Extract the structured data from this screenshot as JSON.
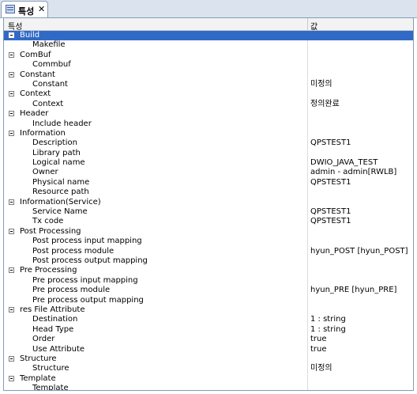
{
  "tab": {
    "title": "특성",
    "close": "✕",
    "icon": "properties-icon"
  },
  "header": {
    "col_property": "특성",
    "col_value": "값"
  },
  "categories": [
    {
      "name": "Build",
      "selected": true,
      "props": [
        {
          "name": "Makefile",
          "value": ""
        }
      ]
    },
    {
      "name": "ComBuf",
      "props": [
        {
          "name": "Commbuf",
          "value": ""
        }
      ]
    },
    {
      "name": "Constant",
      "props": [
        {
          "name": "Constant",
          "value": "미정의"
        }
      ]
    },
    {
      "name": "Context",
      "props": [
        {
          "name": "Context",
          "value": "정의완료"
        }
      ]
    },
    {
      "name": "Header",
      "props": [
        {
          "name": "Include header",
          "value": ""
        }
      ]
    },
    {
      "name": "Information",
      "props": [
        {
          "name": "Description",
          "value": "QPSTEST1"
        },
        {
          "name": "Library path",
          "value": ""
        },
        {
          "name": "Logical name",
          "value": "DWIO_JAVA_TEST"
        },
        {
          "name": "Owner",
          "value": "admin - admin[RWLB]"
        },
        {
          "name": "Physical name",
          "value": "QPSTEST1"
        },
        {
          "name": "Resource path",
          "value": ""
        }
      ]
    },
    {
      "name": "Information(Service)",
      "props": [
        {
          "name": "Service Name",
          "value": "QPSTEST1"
        },
        {
          "name": "Tx code",
          "value": "QPSTEST1"
        }
      ]
    },
    {
      "name": "Post Processing",
      "props": [
        {
          "name": "Post process input mapping",
          "value": ""
        },
        {
          "name": "Post process module",
          "value": "hyun_POST [hyun_POST]"
        },
        {
          "name": "Post process output mapping",
          "value": ""
        }
      ]
    },
    {
      "name": "Pre Processing",
      "props": [
        {
          "name": "Pre process input mapping",
          "value": ""
        },
        {
          "name": "Pre process module",
          "value": "hyun_PRE [hyun_PRE]"
        },
        {
          "name": "Pre process output mapping",
          "value": ""
        }
      ]
    },
    {
      "name": "res File Attribute",
      "props": [
        {
          "name": "Destination",
          "value": "1 : string"
        },
        {
          "name": "Head Type",
          "value": "1 : string"
        },
        {
          "name": "Order",
          "value": "true"
        },
        {
          "name": "Use Attribute",
          "value": "true"
        }
      ]
    },
    {
      "name": "Structure",
      "props": [
        {
          "name": "Structure",
          "value": "미정의"
        }
      ]
    },
    {
      "name": "Template",
      "props": [
        {
          "name": "Template",
          "value": ""
        }
      ]
    }
  ]
}
